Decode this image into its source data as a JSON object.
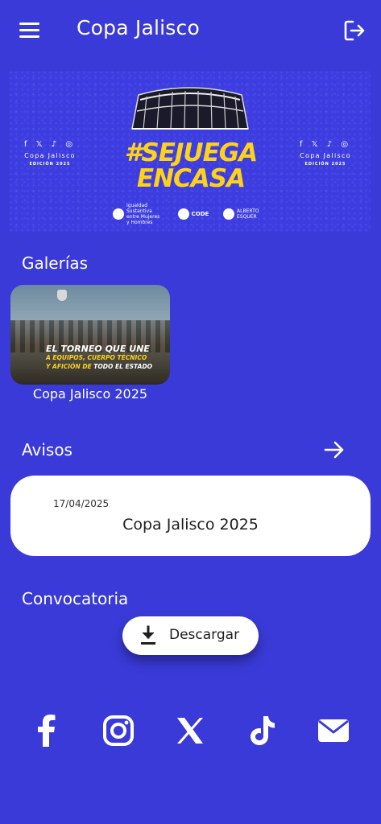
{
  "appbar": {
    "title": "Copa Jalisco",
    "menu_icon": "menu-icon",
    "logout_icon": "logout-icon"
  },
  "banner": {
    "hashtag_line1": "#SEJUEGA",
    "hashtag_line2": "ENCASA",
    "side_title": "Copa Jalisco",
    "side_subtitle": "EDICIÓN 2025",
    "side_icons": "f 𝕏 ♪ ◎",
    "sponsor_1": "Igualdad Sustantiva entre Mujeres y Hombres",
    "sponsor_2": "CODE",
    "sponsor_3": "ALBERTO ESQUER",
    "accent_color": "#ffd21a"
  },
  "galerias": {
    "title": "Galerías",
    "items": [
      {
        "caption": "Copa Jalisco 2025",
        "image_text_1": "EL TORNEO QUE UNE",
        "image_text_2": "A EQUIPOS, CUERPO TÉCNICO",
        "image_text_3": "Y AFICIÓN DE",
        "image_text_3b": "TODO EL ESTADO"
      }
    ]
  },
  "avisos": {
    "title": "Avisos",
    "arrow_icon": "arrow-right-icon",
    "items": [
      {
        "date": "17/04/2025",
        "title": "Copa Jalisco 2025"
      }
    ]
  },
  "convocatoria": {
    "title": "Convocatoria",
    "download_label": "Descargar",
    "download_icon": "download-icon"
  },
  "social": [
    "facebook-icon",
    "instagram-icon",
    "x-icon",
    "tiktok-icon",
    "mail-icon"
  ],
  "colors": {
    "background": "#3a3ad8",
    "card": "#ffffff"
  }
}
